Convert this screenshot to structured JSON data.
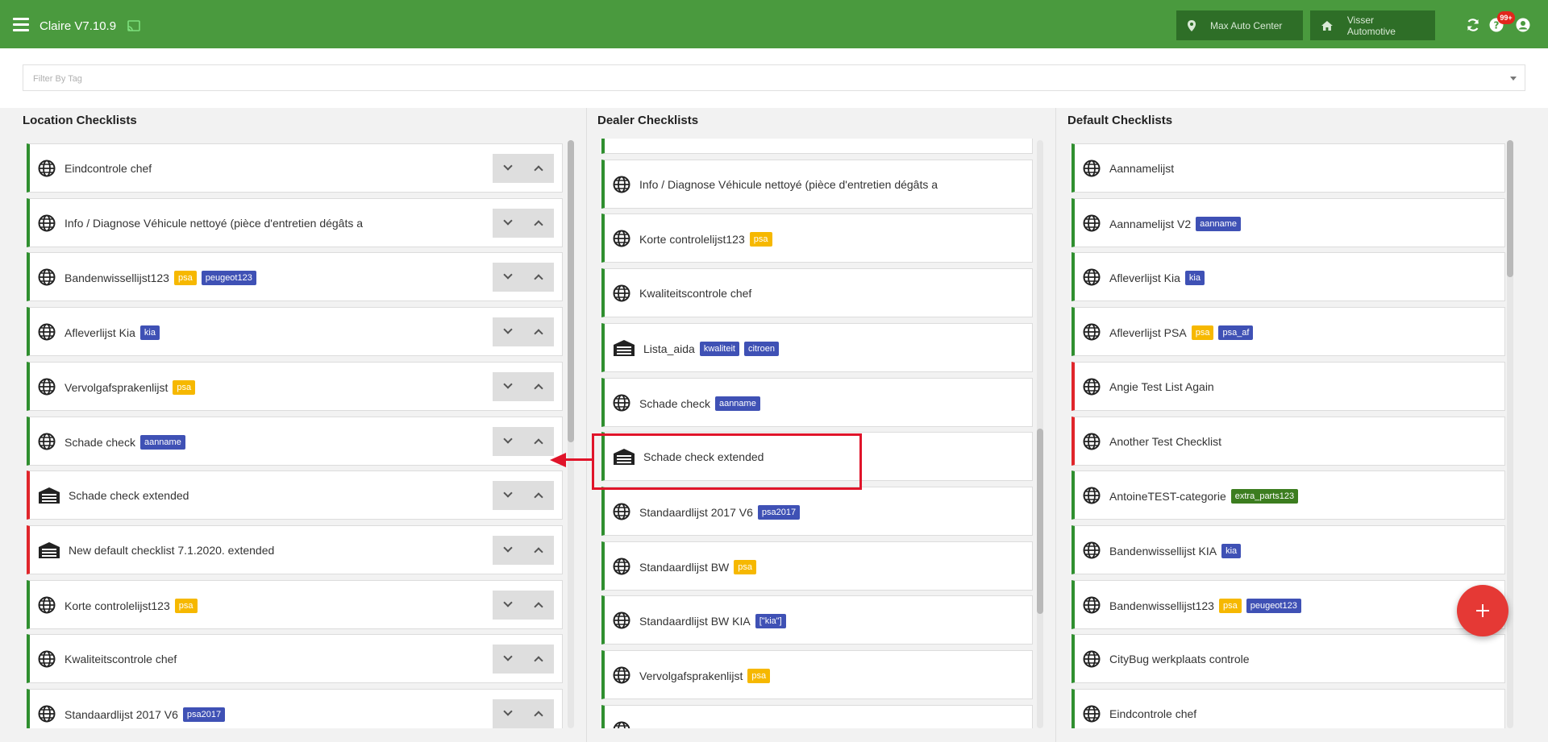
{
  "header": {
    "title": "Claire V7.10.9",
    "location_button": "Max Auto Center",
    "dealer_button": "Visser Automotive",
    "notification_count": "99+",
    "colors": {
      "bar": "#4a9a3e",
      "button": "#2e6e27"
    }
  },
  "filter": {
    "placeholder": "Filter By Tag"
  },
  "columns": {
    "location": {
      "title": "Location Checklists"
    },
    "dealer": {
      "title": "Dealer Checklists"
    },
    "default": {
      "title": "Default Checklists"
    }
  },
  "location_items": [
    {
      "label": "Eindcontrole chef",
      "icon": "globe-icon",
      "status": "green",
      "tags": []
    },
    {
      "label": "Info / Diagnose Véhicule nettoyé (pièce d'entretien dégâts a",
      "icon": "globe-icon",
      "status": "green",
      "tags": []
    },
    {
      "label": "Bandenwissellijst123",
      "icon": "globe-icon",
      "status": "green",
      "tags": [
        {
          "text": "psa",
          "color": "yellow"
        },
        {
          "text": "peugeot123",
          "color": "blue"
        }
      ]
    },
    {
      "label": "Afleverlijst Kia",
      "icon": "globe-icon",
      "status": "green",
      "tags": [
        {
          "text": "kia",
          "color": "blue"
        }
      ]
    },
    {
      "label": "Vervolgafsprakenlijst",
      "icon": "globe-icon",
      "status": "green",
      "tags": [
        {
          "text": "psa",
          "color": "yellow"
        }
      ]
    },
    {
      "label": "Schade check",
      "icon": "globe-icon",
      "status": "green",
      "tags": [
        {
          "text": "aanname",
          "color": "blue"
        }
      ]
    },
    {
      "label": "Schade check extended",
      "icon": "garage-icon",
      "status": "red",
      "tags": []
    },
    {
      "label": "New default checklist 7.1.2020. extended",
      "icon": "garage-icon",
      "status": "red",
      "tags": []
    },
    {
      "label": "Korte controlelijst123",
      "icon": "globe-icon",
      "status": "green",
      "tags": [
        {
          "text": "psa",
          "color": "yellow"
        }
      ]
    },
    {
      "label": "Kwaliteitscontrole chef",
      "icon": "globe-icon",
      "status": "green",
      "tags": []
    },
    {
      "label": "Standaardlijst 2017 V6",
      "icon": "globe-icon",
      "status": "green",
      "tags": [
        {
          "text": "psa2017",
          "color": "blue"
        }
      ]
    }
  ],
  "dealer_items": [
    {
      "label": "",
      "icon": "",
      "status": "green",
      "tags": []
    },
    {
      "label": "Info / Diagnose Véhicule nettoyé (pièce d'entretien dégâts a",
      "icon": "globe-icon",
      "status": "green",
      "tags": []
    },
    {
      "label": "Korte controlelijst123",
      "icon": "globe-icon",
      "status": "green",
      "tags": [
        {
          "text": "psa",
          "color": "yellow"
        }
      ]
    },
    {
      "label": "Kwaliteitscontrole chef",
      "icon": "globe-icon",
      "status": "green",
      "tags": []
    },
    {
      "label": "Lista_aida",
      "icon": "garage-icon",
      "status": "green",
      "tags": [
        {
          "text": "kwaliteit",
          "color": "blue"
        },
        {
          "text": "citroen",
          "color": "blue"
        }
      ]
    },
    {
      "label": "Schade check",
      "icon": "globe-icon",
      "status": "green",
      "tags": [
        {
          "text": "aanname",
          "color": "blue"
        }
      ]
    },
    {
      "label": "Schade check extended",
      "icon": "garage-icon",
      "status": "green",
      "tags": []
    },
    {
      "label": "Standaardlijst 2017 V6",
      "icon": "globe-icon",
      "status": "green",
      "tags": [
        {
          "text": "psa2017",
          "color": "blue"
        }
      ]
    },
    {
      "label": "Standaardlijst BW",
      "icon": "globe-icon",
      "status": "green",
      "tags": [
        {
          "text": "psa",
          "color": "yellow"
        }
      ]
    },
    {
      "label": "Standaardlijst BW KIA",
      "icon": "globe-icon",
      "status": "green",
      "tags": [
        {
          "text": "[\"kia\"]",
          "color": "blue"
        }
      ]
    },
    {
      "label": "Vervolgafsprakenlijst",
      "icon": "globe-icon",
      "status": "green",
      "tags": [
        {
          "text": "psa",
          "color": "yellow"
        }
      ]
    },
    {
      "label": "",
      "icon": "globe-icon",
      "status": "green",
      "tags": []
    }
  ],
  "default_items": [
    {
      "label": "Aannamelijst",
      "icon": "globe-icon",
      "status": "green",
      "tags": []
    },
    {
      "label": "Aannamelijst V2",
      "icon": "globe-icon",
      "status": "green",
      "tags": [
        {
          "text": "aanname",
          "color": "blue"
        }
      ]
    },
    {
      "label": "Afleverlijst Kia",
      "icon": "globe-icon",
      "status": "green",
      "tags": [
        {
          "text": "kia",
          "color": "blue"
        }
      ]
    },
    {
      "label": "Afleverlijst PSA",
      "icon": "globe-icon",
      "status": "green",
      "tags": [
        {
          "text": "psa",
          "color": "yellow"
        },
        {
          "text": "psa_af",
          "color": "blue"
        }
      ]
    },
    {
      "label": "Angie Test List Again",
      "icon": "globe-icon",
      "status": "red",
      "tags": []
    },
    {
      "label": "Another Test Checklist",
      "icon": "globe-icon",
      "status": "red",
      "tags": []
    },
    {
      "label": "AntoineTEST-categorie",
      "icon": "globe-icon",
      "status": "green",
      "tags": [
        {
          "text": "extra_parts123",
          "color": "green"
        }
      ]
    },
    {
      "label": "Bandenwissellijst KIA",
      "icon": "globe-icon",
      "status": "green",
      "tags": [
        {
          "text": "kia",
          "color": "blue"
        }
      ]
    },
    {
      "label": "Bandenwissellijst123",
      "icon": "globe-icon",
      "status": "green",
      "tags": [
        {
          "text": "psa",
          "color": "yellow"
        },
        {
          "text": "peugeot123",
          "color": "blue"
        }
      ]
    },
    {
      "label": "CityBug werkplaats controle",
      "icon": "globe-icon",
      "status": "green",
      "tags": []
    },
    {
      "label": "Eindcontrole chef",
      "icon": "globe-icon",
      "status": "green",
      "tags": []
    }
  ],
  "annotation": {
    "highlight_color": "#e0142a"
  }
}
